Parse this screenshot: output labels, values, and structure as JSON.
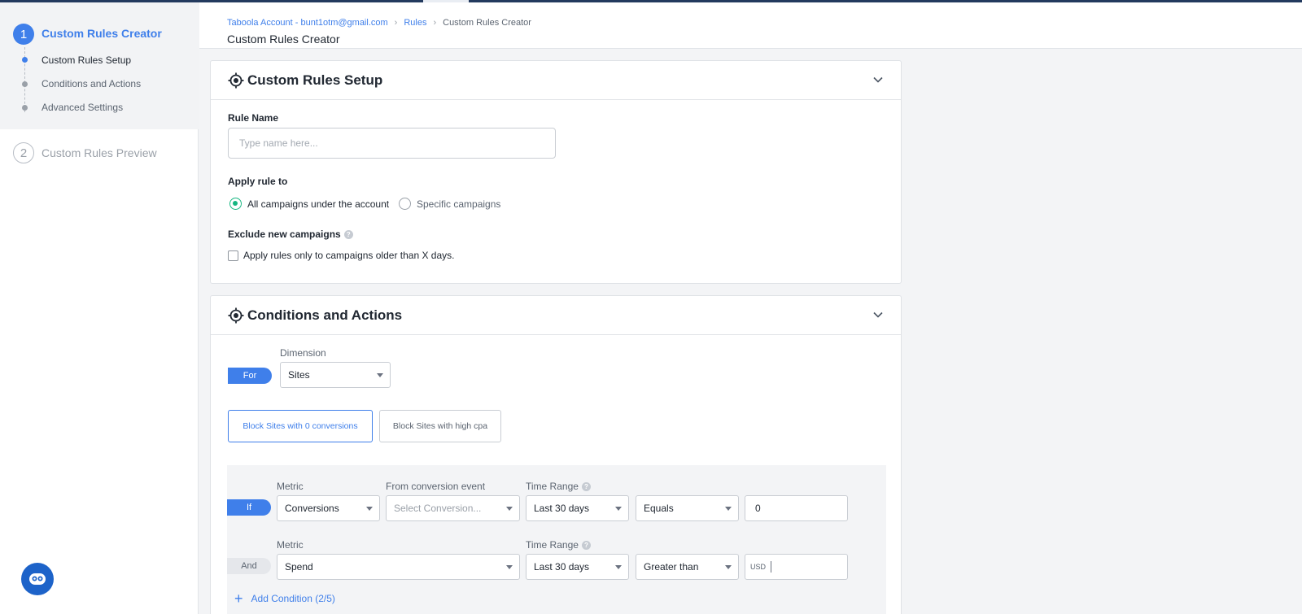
{
  "sidebar": {
    "steps": [
      {
        "number": "1",
        "title": "Custom Rules Creator",
        "sub_items": [
          {
            "label": "Custom Rules Setup",
            "active": true
          },
          {
            "label": "Conditions and Actions",
            "active": false
          },
          {
            "label": "Advanced Settings",
            "active": false
          }
        ]
      },
      {
        "number": "2",
        "title": "Custom Rules Preview"
      }
    ]
  },
  "header": {
    "breadcrumb": [
      "Taboola Account - bunt1otm@gmail.com",
      "Rules",
      "Custom Rules Creator"
    ],
    "title": "Custom Rules Creator"
  },
  "setup": {
    "title": "Custom Rules Setup",
    "rule_name_label": "Rule Name",
    "rule_name_placeholder": "Type name here...",
    "rule_name_value": "",
    "apply_label": "Apply rule to",
    "apply_options": [
      {
        "label": "All campaigns under the account",
        "checked": true
      },
      {
        "label": "Specific campaigns",
        "checked": false
      }
    ],
    "exclude_label": "Exclude new campaigns",
    "exclude_checkbox_label": "Apply rules only to campaigns older than X days.",
    "exclude_checked": false
  },
  "conditions": {
    "title": "Conditions and Actions",
    "for_label": "For",
    "dimension_label": "Dimension",
    "dimension_value": "Sites",
    "presets": [
      {
        "label": "Block Sites with 0 conversions",
        "active": true
      },
      {
        "label": "Block Sites with high cpa",
        "active": false
      }
    ],
    "rows": [
      {
        "prefix": "If",
        "metric_label": "Metric",
        "metric_value": "Conversions",
        "event_label": "From conversion event",
        "event_placeholder": "Select Conversion...",
        "time_label": "Time Range",
        "time_value": "Last 30 days",
        "operator_value": "Equals",
        "value": "0"
      },
      {
        "prefix": "And",
        "metric_label": "Metric",
        "metric_value": "Spend",
        "time_label": "Time Range",
        "time_value": "Last 30 days",
        "operator_value": "Greater than",
        "currency": "USD",
        "value": ""
      }
    ],
    "add_condition_label": "Add Condition (2/5)"
  },
  "icons": {
    "section_icon": "target-icon",
    "chevron": "chevron-down-icon",
    "help": "help-icon",
    "chat": "chat-bot-icon",
    "plus": "plus-icon"
  },
  "colors": {
    "accent": "#3f7fea",
    "radio_checked": "#15b680",
    "chat_button": "#1d63c9",
    "top_strip": "#233a5e"
  }
}
